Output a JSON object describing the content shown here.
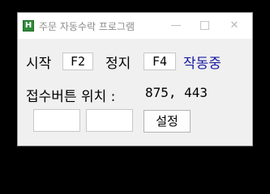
{
  "window": {
    "title": "주문 자동수락 프로그램",
    "app_icon_letter": "H",
    "controls": {
      "minimize": "—",
      "close": "✕"
    }
  },
  "start": {
    "label": "시작",
    "key": "F2"
  },
  "stop": {
    "label": "정지",
    "key": "F4"
  },
  "status_text": "작동중",
  "position": {
    "label": "접수버튼 위치 :",
    "value": "875, 443"
  },
  "inputs": {
    "x_value": "",
    "y_value": ""
  },
  "set_button_label": "설정",
  "colors": {
    "status": "#1a1aa0",
    "app_icon": "#2e8b3a"
  }
}
